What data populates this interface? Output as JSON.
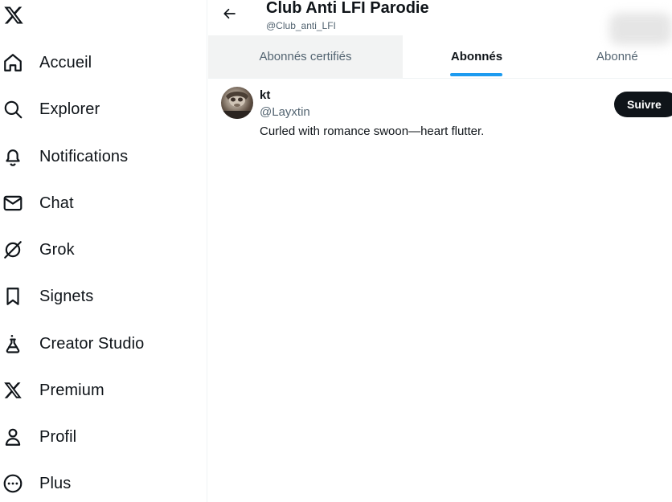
{
  "sidebar": {
    "items": [
      {
        "label": "Accueil",
        "icon": "home-icon"
      },
      {
        "label": "Explorer",
        "icon": "search-icon"
      },
      {
        "label": "Notifications",
        "icon": "bell-icon"
      },
      {
        "label": "Chat",
        "icon": "mail-icon"
      },
      {
        "label": "Grok",
        "icon": "grok-icon"
      },
      {
        "label": "Signets",
        "icon": "bookmark-icon"
      },
      {
        "label": "Creator Studio",
        "icon": "flask-icon"
      },
      {
        "label": "Premium",
        "icon": "x-logo-icon"
      },
      {
        "label": "Profil",
        "icon": "person-icon"
      },
      {
        "label": "Plus",
        "icon": "more-circle-icon"
      }
    ]
  },
  "header": {
    "title": "Club Anti LFI Parodie",
    "handle": "@Club_anti_LFI"
  },
  "tabs": [
    {
      "label": "Abonnés certifiés"
    },
    {
      "label": "Abonnés",
      "active": true
    },
    {
      "label": "Abonné"
    }
  ],
  "users": [
    {
      "name": "kt",
      "handle": "@Layxtin",
      "bio": "Curled with romance swoon—heart flutter.",
      "button": "Suivre"
    }
  ],
  "colors": {
    "accent": "#1d9bf0",
    "text": "#0f1419",
    "muted": "#536471"
  }
}
